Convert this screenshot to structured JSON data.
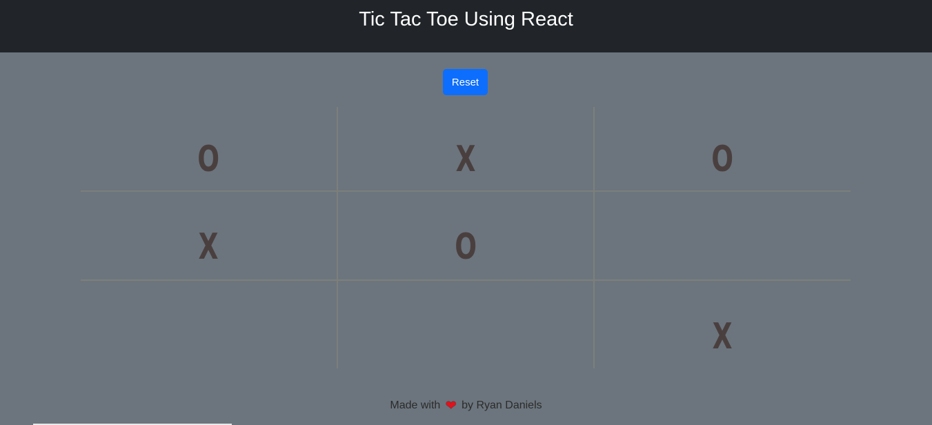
{
  "header": {
    "title": "Tic Tac Toe Using React"
  },
  "controls": {
    "reset_label": "Reset"
  },
  "board": {
    "cells": [
      "O",
      "X",
      "O",
      "X",
      "O",
      "",
      "",
      "",
      "X"
    ]
  },
  "footer": {
    "prefix": "Made with",
    "heart_icon": "heart-icon",
    "suffix": "by Ryan Daniels"
  },
  "colors": {
    "background": "#6c757d",
    "header": "#212529",
    "button": "#0d6efd",
    "mark": "#4a3f3f",
    "grid_line": "#7d7f7a",
    "heart": "#e0121b"
  }
}
